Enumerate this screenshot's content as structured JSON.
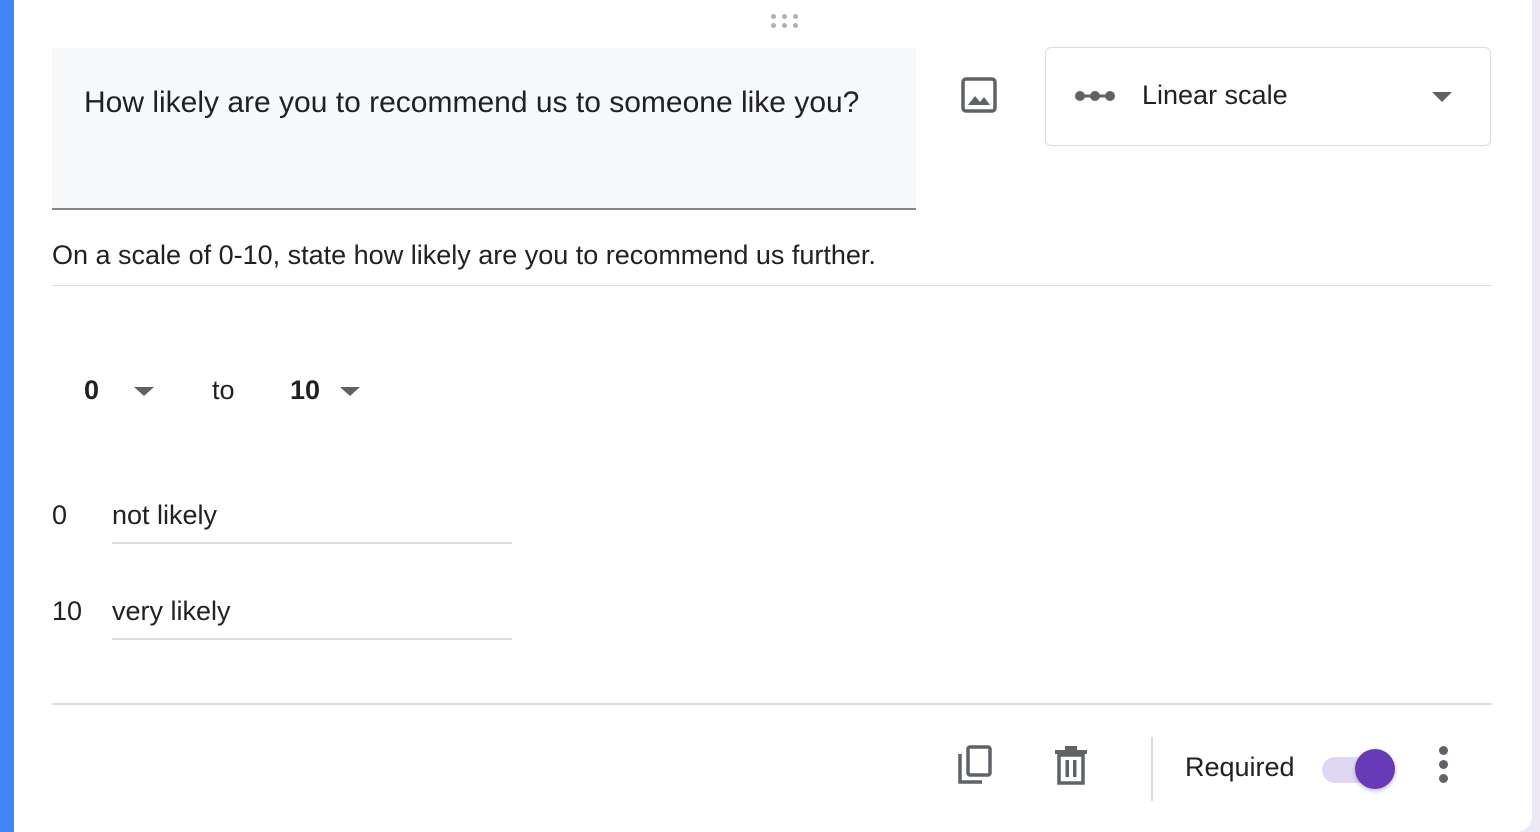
{
  "question": {
    "title": "How likely are you to recommend us to someone like you?",
    "description": "On a scale of 0-10, state how likely are you to recommend us further.",
    "type": {
      "icon": "linear-scale-icon",
      "label": "Linear scale"
    }
  },
  "scale": {
    "min": "0",
    "to_label": "to",
    "max": "10",
    "labels": [
      {
        "value": "0",
        "text": "not likely"
      },
      {
        "value": "10",
        "text": "very likely"
      }
    ]
  },
  "footer": {
    "required_label": "Required",
    "required_on": true
  },
  "colors": {
    "accent": "#673ab7",
    "card_left_border": "#4285f4",
    "toggle_track": "#e0d8f3"
  }
}
